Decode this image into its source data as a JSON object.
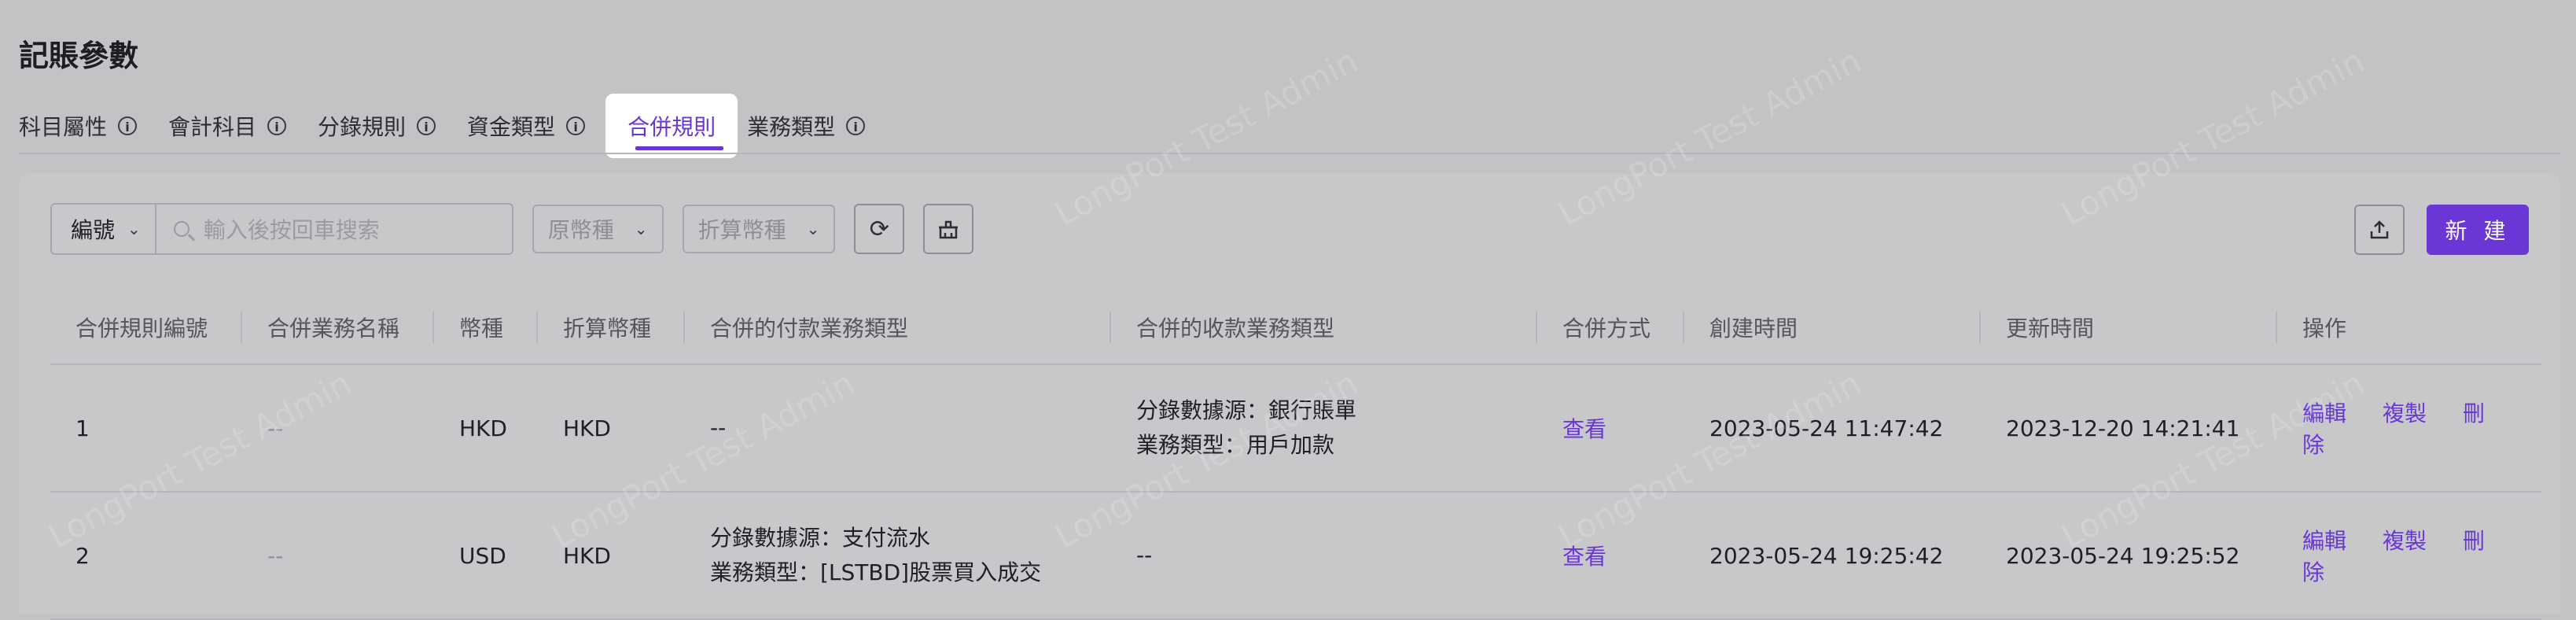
{
  "page": {
    "title": "記賬參數"
  },
  "tabs": [
    {
      "label": "科目屬性",
      "active": false
    },
    {
      "label": "會計科目",
      "active": false
    },
    {
      "label": "分錄規則",
      "active": false
    },
    {
      "label": "資金類型",
      "active": false
    },
    {
      "label": "合併規則",
      "active": true
    },
    {
      "label": "業務類型",
      "active": false
    }
  ],
  "toolbar": {
    "field_select": "編號",
    "search_placeholder": "輸入後按回車搜索",
    "original_currency": "原幣種",
    "converted_currency": "折算幣種",
    "new_label": "新 建"
  },
  "table": {
    "columns": [
      "合併規則編號",
      "合併業務名稱",
      "幣種",
      "折算幣種",
      "合併的付款業務類型",
      "合併的收款業務類型",
      "合併方式",
      "創建時間",
      "更新時間",
      "操作"
    ],
    "rows": [
      {
        "id": "1",
        "name": "--",
        "currency": "HKD",
        "converted": "HKD",
        "pay_line1": "--",
        "pay_line2": "",
        "recv_line1": "分錄數據源：銀行賬單",
        "recv_line2": "業務類型：用戶加款",
        "method": "查看",
        "created": "2023-05-24 11:47:42",
        "updated": "2023-12-20 14:21:41",
        "edit": "編輯",
        "copy": "複製",
        "delete": "刪除"
      },
      {
        "id": "2",
        "name": "--",
        "currency": "USD",
        "converted": "HKD",
        "pay_line1": "分錄數據源：支付流水",
        "pay_line2": "業務類型：[LSTBD]股票買入成交",
        "recv_line1": "--",
        "recv_line2": "",
        "method": "查看",
        "created": "2023-05-24 19:25:42",
        "updated": "2023-05-24 19:25:52",
        "edit": "編輯",
        "copy": "複製",
        "delete": "刪除"
      }
    ]
  },
  "watermark": "LongPort Test Admin"
}
